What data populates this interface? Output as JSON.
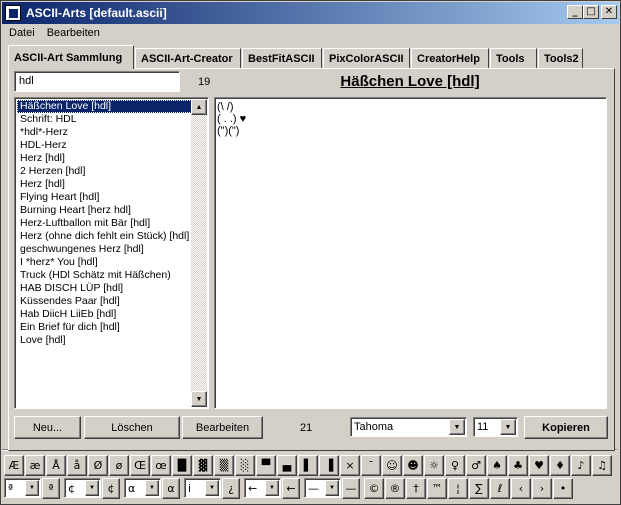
{
  "window": {
    "title": "ASCII-Arts [default.ascii]",
    "minimize": "_",
    "maximize": "□",
    "close": "✕"
  },
  "menu": [
    {
      "label": "Datei"
    },
    {
      "label": "Bearbeiten"
    }
  ],
  "tabs": [
    {
      "label": "ASCII-Art Sammlung",
      "active": true
    },
    {
      "label": "ASCII-Art-Creator"
    },
    {
      "label": "BestFitASCII"
    },
    {
      "label": "PixColorASCII"
    },
    {
      "label": "CreatorHelp"
    },
    {
      "label": "Tools"
    },
    {
      "label": "Tools2"
    }
  ],
  "search": {
    "value": "hdl",
    "count": "19"
  },
  "preview": {
    "title": "Häßchen Love [hdl]",
    "lines": [
      "(\\ /)",
      "( . .) ♥",
      "(\")(\")"
    ]
  },
  "list": {
    "items": [
      "Häßchen Love [hdl]",
      "Schrift: HDL",
      "*hdl*-Herz",
      "HDL-Herz",
      "Herz [hdl]",
      "2 Herzen [hdl]",
      "Herz [hdl]",
      "Flying Heart [hdl]",
      "Burning Heart [herz hdl]",
      "Herz-Luftballon mit Bär [hdl]",
      "Herz (ohne dich fehlt ein Stück) [hdl]",
      "geschwungenes Herz [hdl]",
      "I *herz* You [hdl]",
      "Truck (HDl Schätz mit Häßchen)",
      "HAB DISCH LÜP [hdl]",
      "Küssendes Paar [hdl]",
      "Hab DiicH LiiEb [hdl]",
      "Ein Brief für dich [hdl]",
      "Love [hdl]"
    ],
    "selected_index": 0,
    "scroll_up": "▲",
    "scroll_down": "▼"
  },
  "actions": {
    "new_label": "Neu...",
    "delete_label": "Löschen",
    "edit_label": "Bearbeiten",
    "count": "21",
    "font_value": "Tahoma",
    "size_value": "11",
    "copy_label": "Kopieren"
  },
  "symbols": [
    "Æ",
    "æ",
    "Å",
    "å",
    "Ø",
    "ø",
    "Œ",
    "œ",
    "█",
    "▓",
    "▒",
    "░",
    "▀",
    "▄",
    "▌",
    "▐",
    "×",
    "¯",
    "☺",
    "☻",
    "☼",
    "♀",
    "♂",
    "♠",
    "♣",
    "♥",
    "♦",
    "♪",
    "♫"
  ],
  "bottom_row": [
    {
      "value": "ª",
      "btn": "ª"
    },
    {
      "value": "¢",
      "btn": "¢"
    },
    {
      "value": "α",
      "btn": "α"
    },
    {
      "value": "i",
      "btn": "¿"
    },
    {
      "value": "←",
      "btn": "←"
    },
    {
      "value": "—",
      "btn": "—"
    }
  ],
  "bottom_buttons": [
    "©",
    "®",
    "†",
    "™",
    "¦",
    "∑",
    "ℓ",
    "‹",
    "›",
    "•"
  ]
}
